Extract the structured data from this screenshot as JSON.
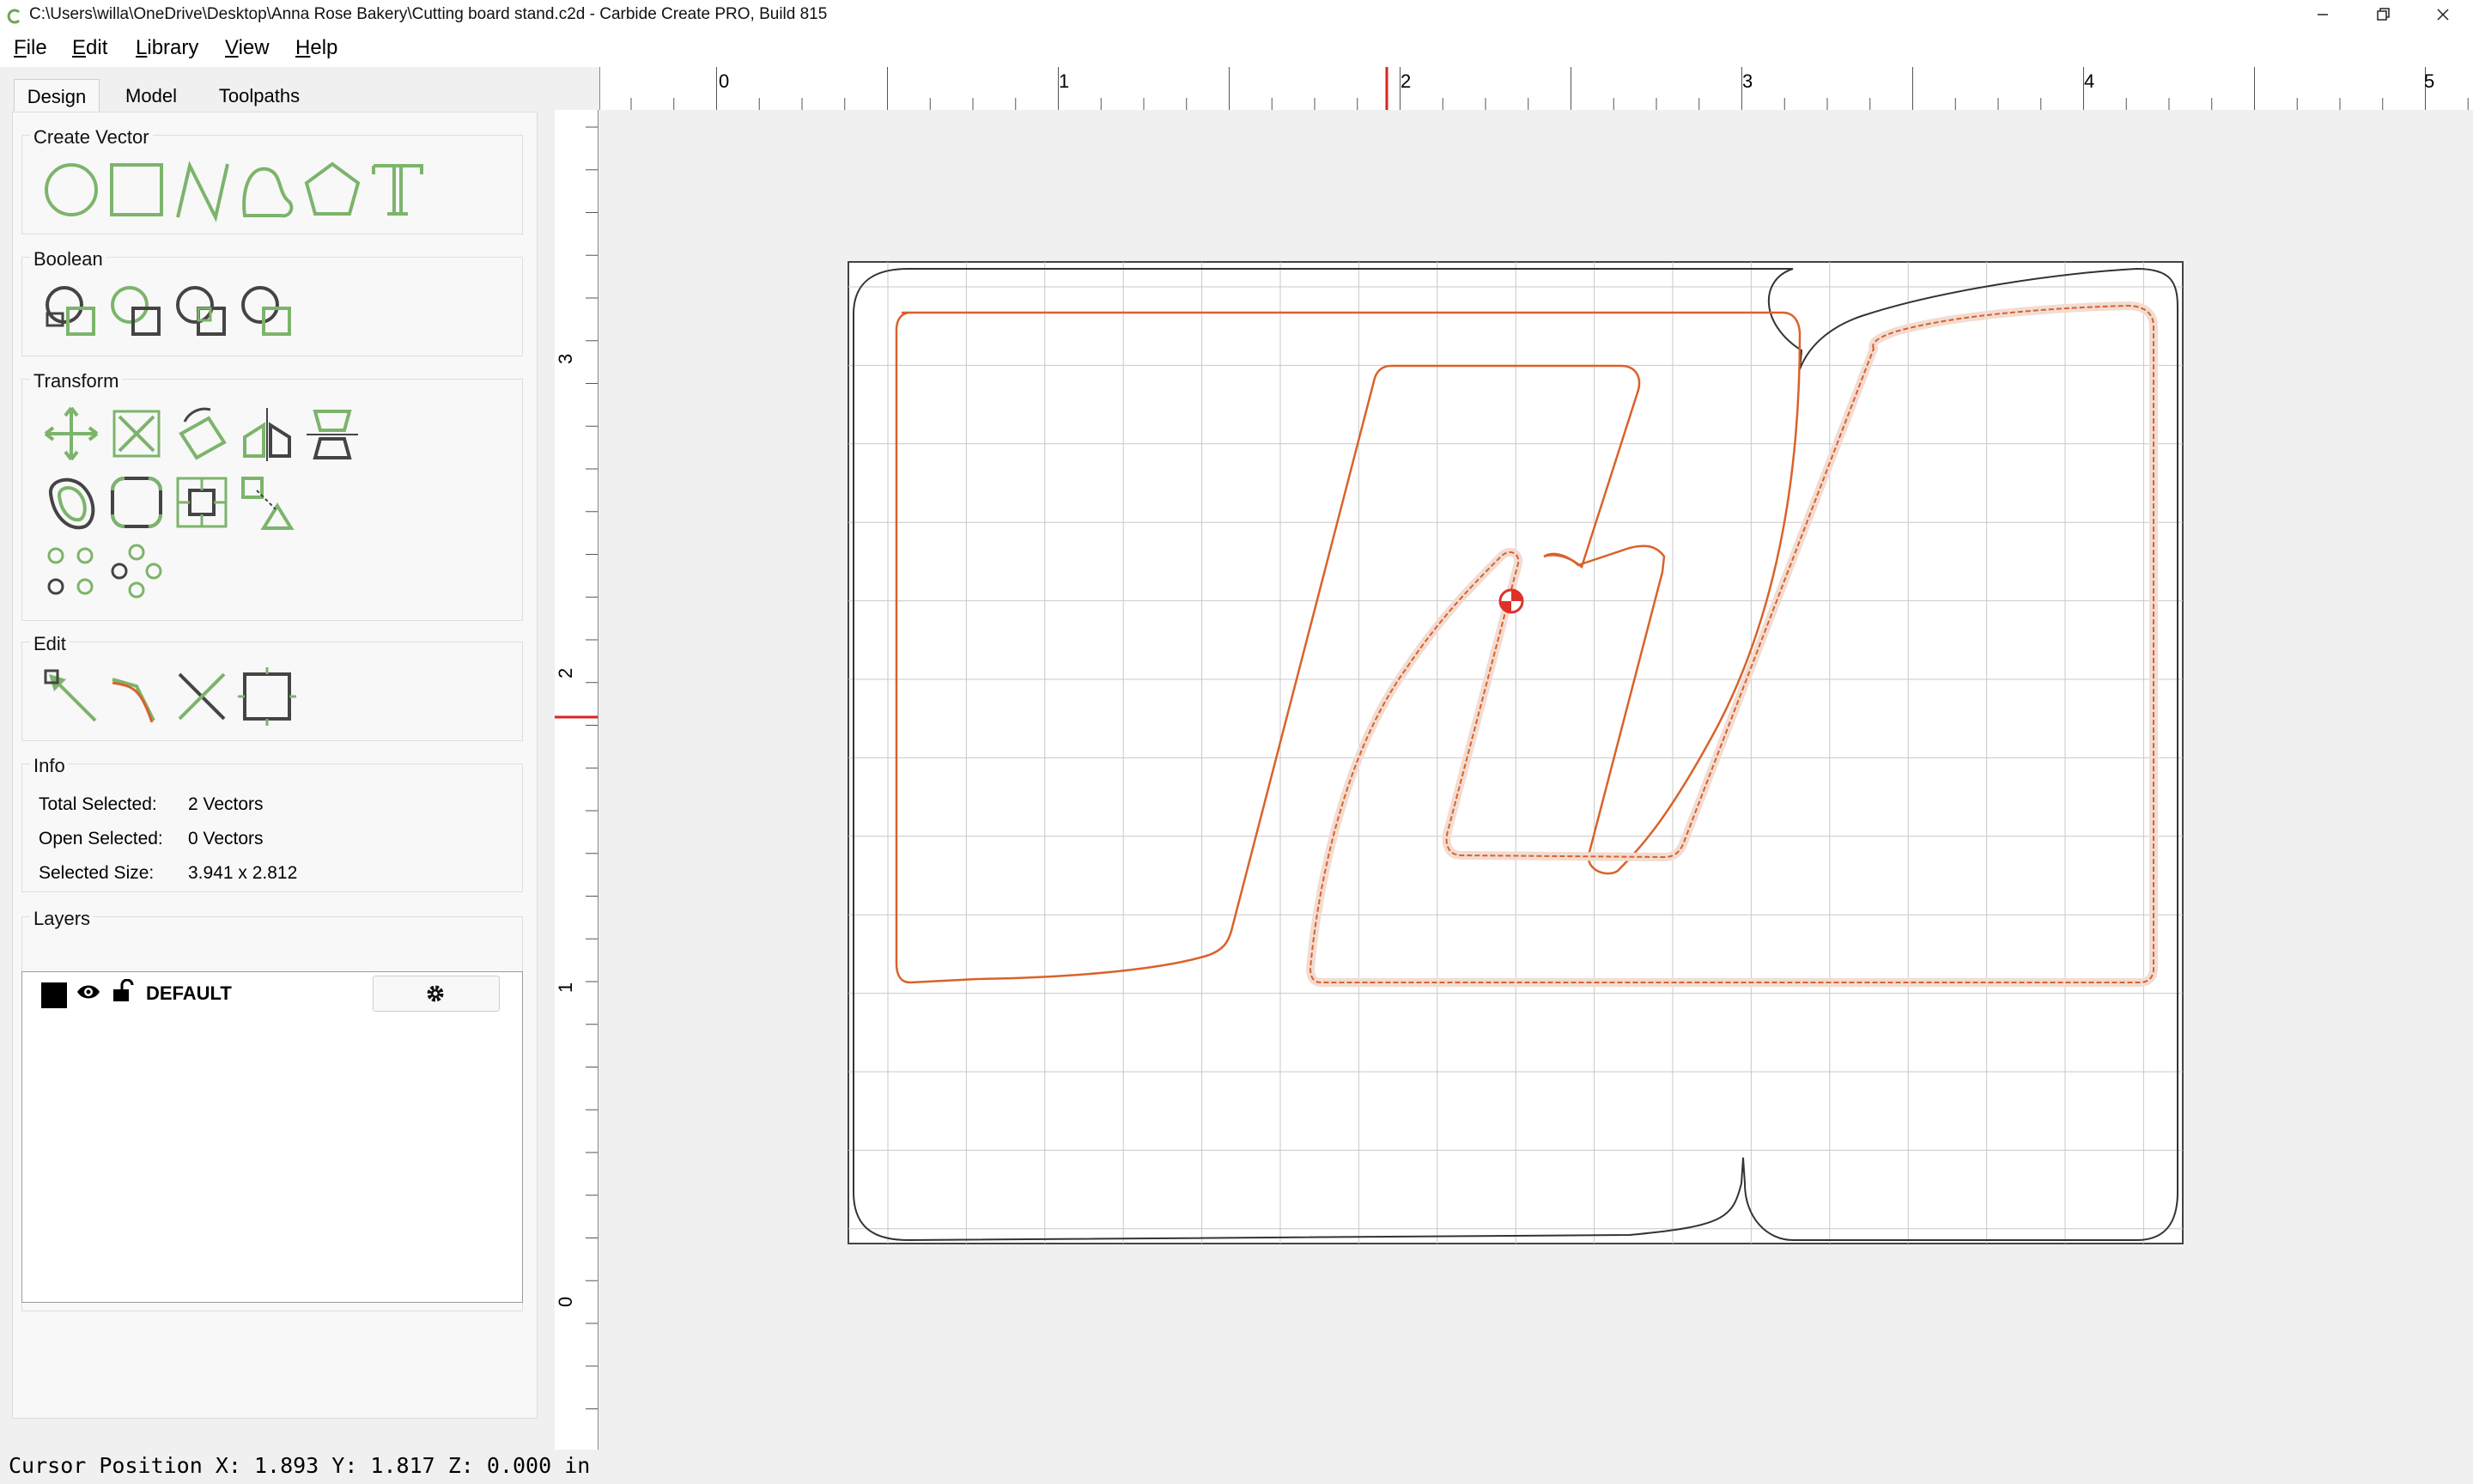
{
  "window": {
    "title": "C:\\Users\\willa\\OneDrive\\Desktop\\Anna Rose Bakery\\Cutting board stand.c2d - Carbide Create PRO, Build 815",
    "controls": [
      "minimize",
      "restore",
      "close"
    ]
  },
  "menu": [
    "File",
    "Edit",
    "Library",
    "View",
    "Help"
  ],
  "tabs": [
    {
      "label": "Design",
      "active": true
    },
    {
      "label": "Model",
      "active": false
    },
    {
      "label": "Toolpaths",
      "active": false
    }
  ],
  "sections": {
    "create_vector": "Create Vector",
    "boolean": "Boolean",
    "transform": "Transform",
    "edit": "Edit",
    "info": "Info",
    "layers": "Layers"
  },
  "create_vector_tools": [
    "circle-icon",
    "rectangle-icon",
    "polyline-icon",
    "curve-icon",
    "polygon-icon",
    "text-icon"
  ],
  "boolean_tools": [
    "boolean-weld-icon",
    "boolean-subtract-icon",
    "boolean-intersect-icon",
    "boolean-trim-icon"
  ],
  "transform_tools": [
    "move-icon",
    "scale-icon",
    "rotate-icon",
    "mirror-icon",
    "align-icon",
    "offset-icon",
    "fillet-icon",
    "center-icon",
    "distribute-icon",
    "grid-array-icon",
    "circular-array-icon"
  ],
  "edit_tools": [
    "node-edit-icon",
    "smooth-icon",
    "trim-vector-icon",
    "bounding-box-icon"
  ],
  "info": {
    "total_selected_label": "Total Selected:",
    "total_selected_value": "2 Vectors",
    "open_selected_label": "Open Selected:",
    "open_selected_value": "0 Vectors",
    "selected_size_label": "Selected Size:",
    "selected_size_value": "3.941 x 2.812"
  },
  "layers": [
    {
      "name": "DEFAULT",
      "color": "#000000",
      "visible": true,
      "locked": false
    }
  ],
  "rulers": {
    "horizontal": [
      "0",
      "1",
      "2",
      "3",
      "4",
      "5"
    ],
    "vertical": [
      "0",
      "1",
      "2",
      "3"
    ]
  },
  "colors": {
    "accent_green": "#7cb46b",
    "toolpath_orange": "#d9622b",
    "cursor_marker_red": "#e0302a"
  },
  "status": "Cursor Position X: 1.893 Y: 1.817 Z: 0.000 in"
}
